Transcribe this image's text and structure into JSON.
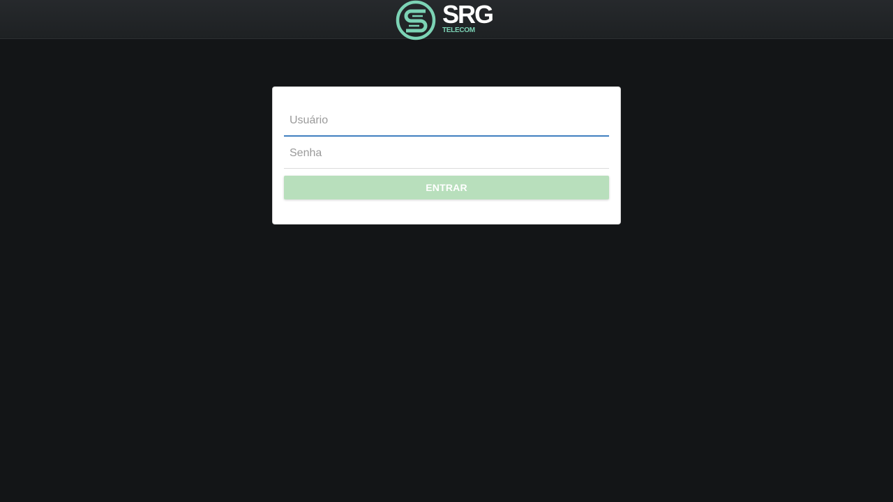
{
  "header": {
    "logo": {
      "name": "SRG",
      "subtitle": "TELECOM",
      "icon": "srg-s-logo-icon",
      "colors": {
        "mark": "#7cd3b5",
        "name": "#ffffff",
        "subtitle": "#7cd3b5"
      }
    }
  },
  "login": {
    "username": {
      "value": "",
      "placeholder": "Usuário"
    },
    "password": {
      "value": "",
      "placeholder": "Senha"
    },
    "submit_label": "ENTRAR"
  },
  "colors": {
    "background": "#131517",
    "topbar": "#232629",
    "card": "#ffffff",
    "focus_underline": "#3f7fbf",
    "button": "#b8dfbc"
  }
}
